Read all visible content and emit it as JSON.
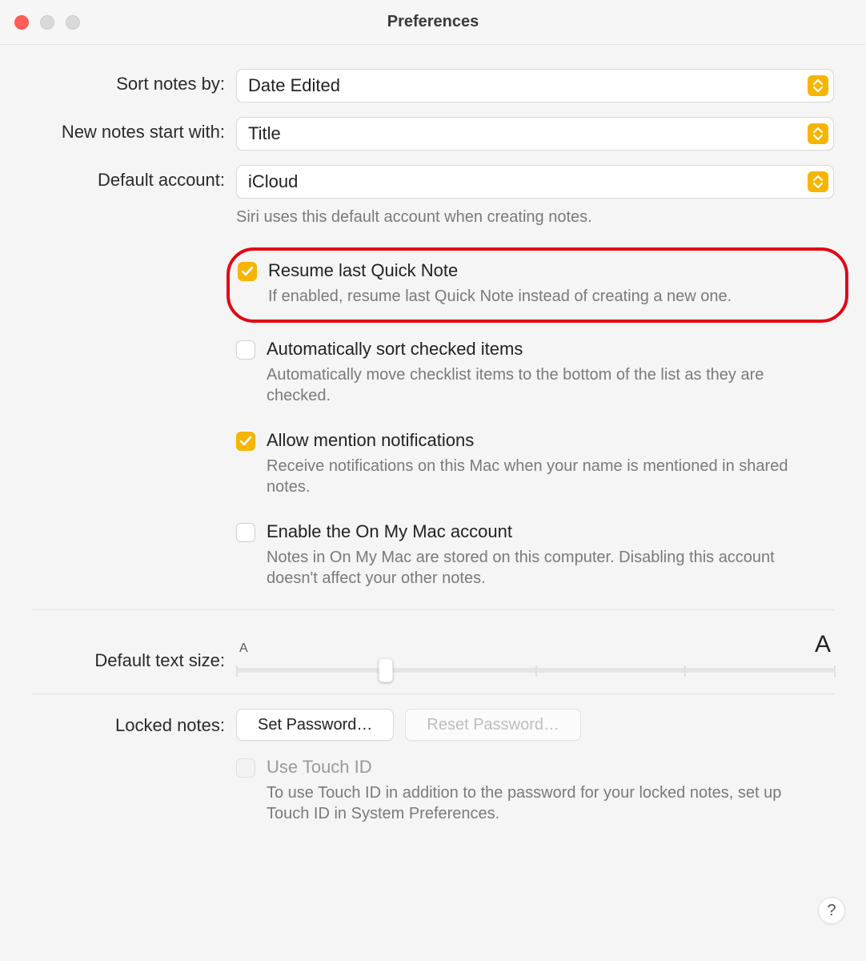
{
  "window": {
    "title": "Preferences"
  },
  "labels": {
    "sort_notes_by": "Sort notes by:",
    "new_notes_start_with": "New notes start with:",
    "default_account": "Default account:",
    "default_text_size": "Default text size:",
    "locked_notes": "Locked notes:"
  },
  "selects": {
    "sort_notes_by": "Date Edited",
    "new_notes_start_with": "Title",
    "default_account": "iCloud"
  },
  "default_account_hint": "Siri uses this default account when creating notes.",
  "options": {
    "resume_quick_note": {
      "label": "Resume last Quick Note",
      "desc": "If enabled, resume last Quick Note instead of creating a new one.",
      "checked": true
    },
    "auto_sort_checked": {
      "label": "Automatically sort checked items",
      "desc": "Automatically move checklist items to the bottom of the list as they are checked.",
      "checked": false
    },
    "allow_mentions": {
      "label": "Allow mention notifications",
      "desc": "Receive notifications on this Mac when your name is mentioned in shared notes.",
      "checked": true
    },
    "on_my_mac": {
      "label": "Enable the On My Mac account",
      "desc": "Notes in On My Mac are stored on this computer. Disabling this account doesn't affect your other notes.",
      "checked": false
    },
    "use_touch_id": {
      "label": "Use Touch ID",
      "desc": "To use Touch ID in addition to the password for your locked notes, set up Touch ID in System Preferences.",
      "checked": false,
      "disabled": true
    }
  },
  "text_size": {
    "small_marker": "A",
    "large_marker": "A"
  },
  "buttons": {
    "set_password": "Set Password…",
    "reset_password": "Reset Password…",
    "help": "?"
  }
}
